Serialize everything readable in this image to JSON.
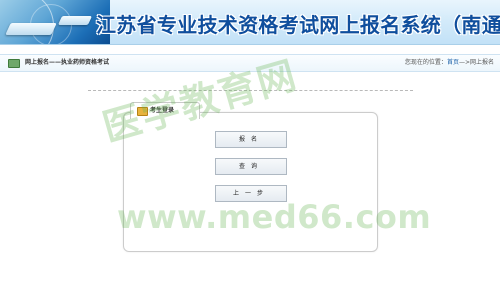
{
  "header": {
    "title": "江苏省专业技术资格考试网上报名系统（南通考区）"
  },
  "navbar": {
    "title": "网上报名——执业药师资格考试",
    "location_prefix": "您现在的位置：",
    "breadcrumb_home": "首页",
    "breadcrumb_separator": "—>",
    "breadcrumb_current": "网上报名"
  },
  "login": {
    "tab_label": "考生登录",
    "register_label": "报名",
    "query_label": "查询",
    "prev_label": "上一步"
  },
  "watermark": {
    "cn": "医学教育网",
    "url": "www.med66.com"
  },
  "colors": {
    "title_blue": "#0f4e9d",
    "watermark_green": "#64b450",
    "panel_border": "#cccccc"
  }
}
